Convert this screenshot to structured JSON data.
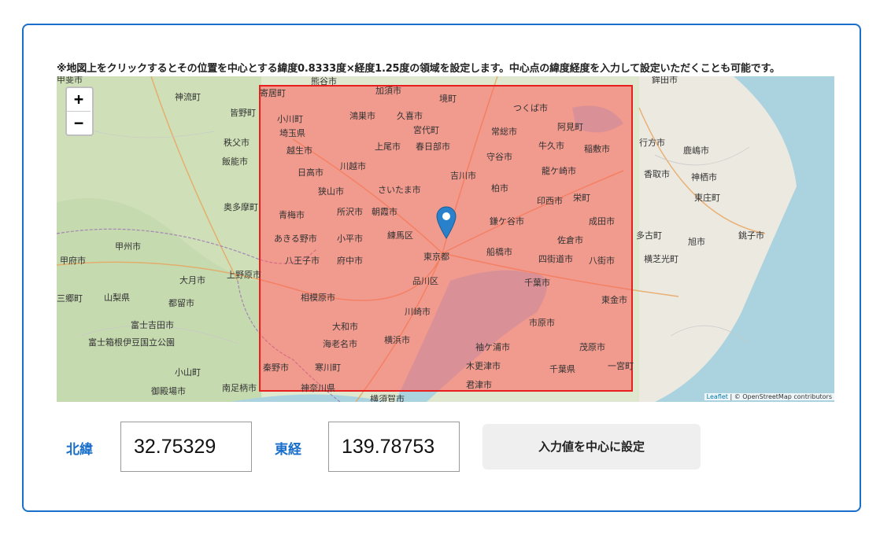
{
  "notice": "※地図上をクリックするとその位置を中心とする緯度0.8333度×経度1.25度の領域を設定します。中心点の緯度経度を入力して設定いただくことも可能です。",
  "map": {
    "zoom_in": "+",
    "zoom_out": "−",
    "attribution_leaflet": "Leaflet",
    "attribution_rest": "| © OpenStreetMap contributors",
    "places": [
      "熊谷市",
      "加須市",
      "寄居町",
      "神流町",
      "鴻巣市",
      "久喜市",
      "境町",
      "つくば市",
      "小川町",
      "埼玉県",
      "宮代町",
      "常総市",
      "阿見町",
      "皆野町",
      "秩父市",
      "越生市",
      "上尾市",
      "春日部市",
      "牛久市",
      "稲敷市",
      "行方市",
      "鹿嶋市",
      "日高市",
      "川越市",
      "守谷市",
      "龍ケ崎市",
      "香取市",
      "神栖市",
      "吉川市",
      "飯能市",
      "狭山市",
      "さいたま市",
      "柏市",
      "東庄町",
      "奥多摩町",
      "青梅市",
      "所沢市",
      "朝霞市",
      "印西市",
      "栄町",
      "成田市",
      "銚子市",
      "あきる野市",
      "小平市",
      "練馬区",
      "鎌ケ谷市",
      "多古町",
      "旭市",
      "甲府市",
      "甲州市",
      "佐倉市",
      "八王子市",
      "府中市",
      "東京都",
      "船橋市",
      "四街道市",
      "八街市",
      "横芝光町",
      "上野原市",
      "大月市",
      "品川区",
      "千葉市",
      "山梨県",
      "都留市",
      "相模原市",
      "東金市",
      "川崎市",
      "市原市",
      "富士吉田市",
      "大和市",
      "横浜市",
      "富士箱根伊豆国立公園",
      "海老名市",
      "袖ケ浦市",
      "茂原市",
      "木更津市",
      "秦野市",
      "寒川町",
      "小山町",
      "一宮町",
      "千葉県",
      "御殿場市",
      "南足柄市",
      "神奈川県",
      "君津市",
      "横須賀市",
      "鉾田市",
      "三郷町",
      "甲斐市"
    ]
  },
  "form": {
    "lat_label": "北緯",
    "lat_value": "32.75329",
    "lng_label": "東経",
    "lng_value": "139.78753",
    "submit_label": "入力値を中心に設定"
  },
  "colors": {
    "accent": "#1a6fcb",
    "selection_stroke": "#e81f1f",
    "selection_fill": "#ff5a5a",
    "marker": "#2a81cb"
  }
}
